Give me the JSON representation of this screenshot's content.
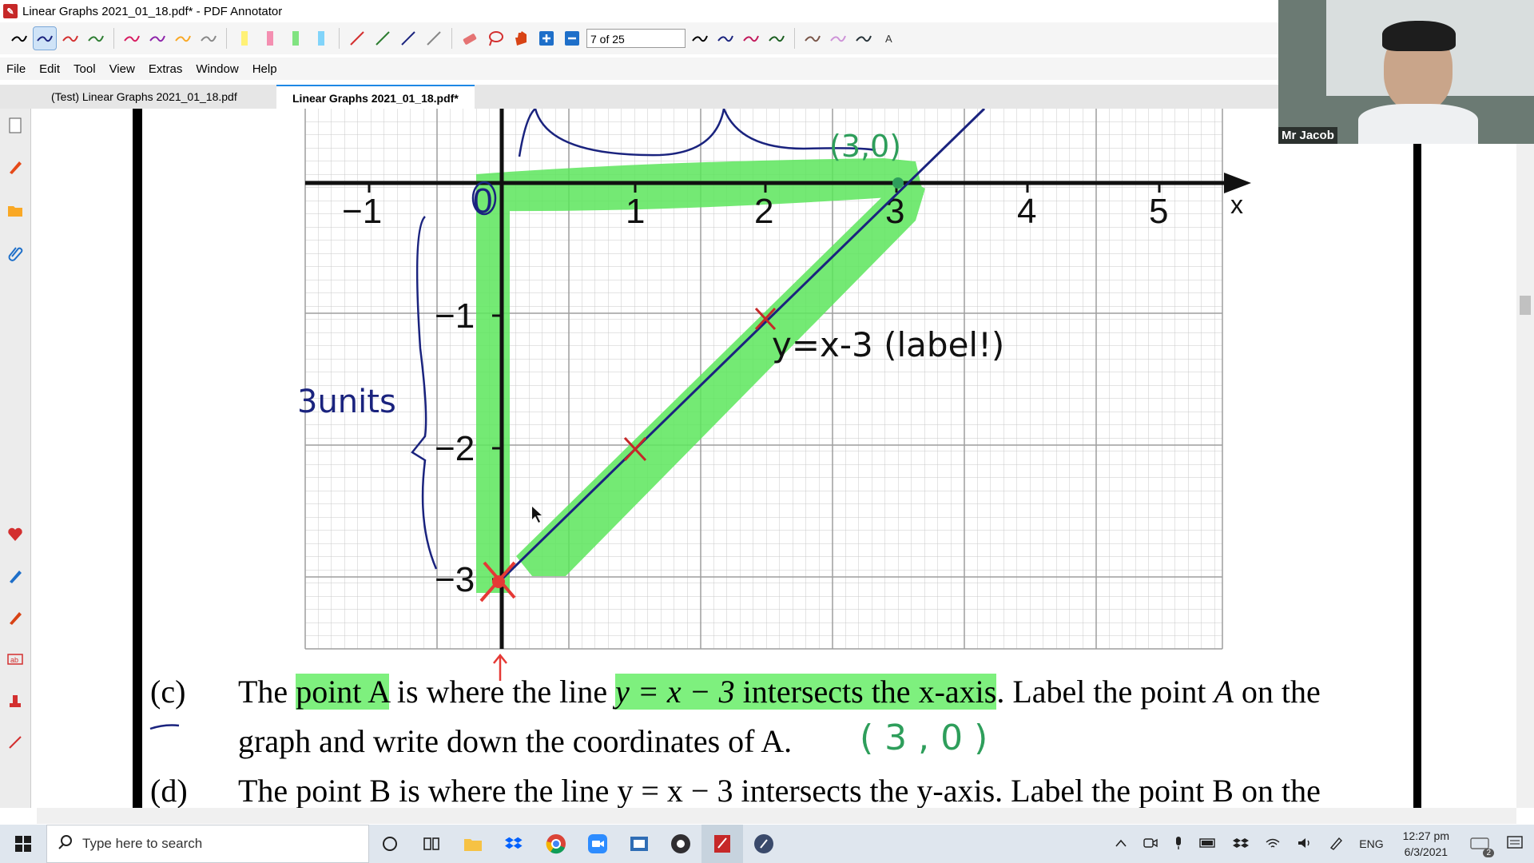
{
  "window": {
    "title": "Linear Graphs 2021_01_18.pdf* - PDF Annotator"
  },
  "toolbar": {
    "page_indicator": "7 of 25"
  },
  "menu": {
    "items": [
      "File",
      "Edit",
      "Tool",
      "View",
      "Extras",
      "Window",
      "Help"
    ]
  },
  "tabs": [
    {
      "label": "(Test) Linear Graphs 2021_01_18.pdf"
    },
    {
      "label": "Linear Graphs 2021_01_18.pdf*"
    }
  ],
  "graph": {
    "x_ticks": [
      "−1",
      "0",
      "1",
      "2",
      "3",
      "4",
      "5"
    ],
    "y_ticks": [
      "−1",
      "−2",
      "−3"
    ],
    "x_axis_label": "x",
    "annotations": {
      "point_label": "(3,0)",
      "line_label": "y=x-3 (label!)",
      "units_label": "3units"
    }
  },
  "question_c": {
    "label": "(c)",
    "line1_parts": [
      "The ",
      "point A",
      " is where the line ",
      "y = x − 3",
      " intersects the x-axis",
      ". Label the point ",
      "A",
      " on the"
    ],
    "line2": "graph and write down the coordinates of A.",
    "answer": "( 3 , 0     )"
  },
  "question_d": {
    "label": "(d)",
    "line1": "The point B is where the line  y = x − 3  intersects the y-axis. Label the point B on the"
  },
  "webcam": {
    "name": "Mr Jacob"
  },
  "taskbar": {
    "search_placeholder": "Type here to search",
    "language": "ENG",
    "time": "12:27 pm",
    "date": "6/3/2021",
    "notification_count": "2"
  }
}
